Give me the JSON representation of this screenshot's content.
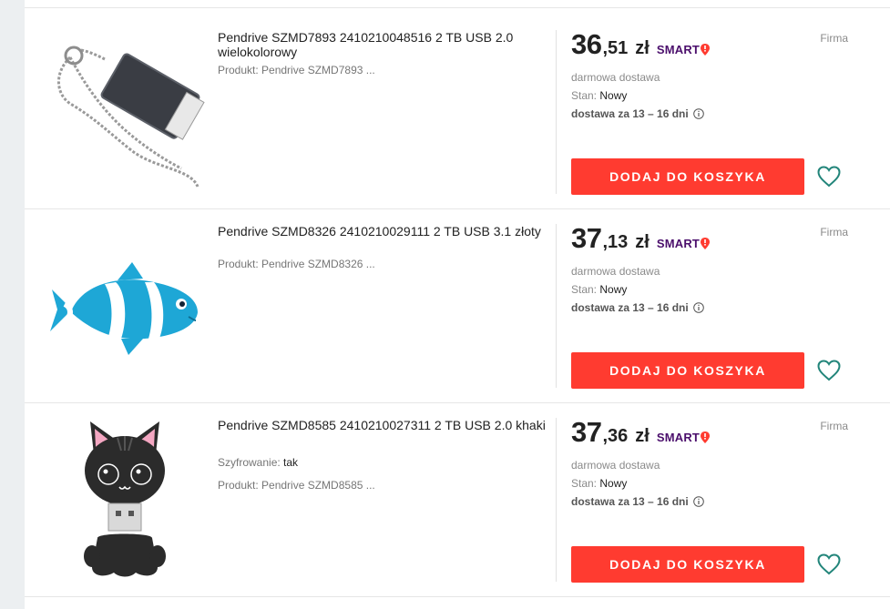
{
  "colors": {
    "button": "#ff3b30",
    "smart": "#4b0f6c",
    "heart": "#22857a"
  },
  "listings": [
    {
      "title": "Pendrive SZMD7893 2410210048516 2 TB USB 2.0 wielokolorowy",
      "attributes": [
        {
          "label": "Produkt: Pendrive SZMD7893 ..."
        }
      ],
      "price_int": "36",
      "price_dec": ",51",
      "currency": "zł",
      "smart": "SMART",
      "seller_type": "Firma",
      "shipping": "darmowa dostawa",
      "condition_label": "Stan: ",
      "condition_value": "Nowy",
      "delivery": "dostawa za 13 – 16 dni",
      "cart_button": "DODAJ DO KOSZYKA",
      "image": "usb-keychain-image"
    },
    {
      "title": "Pendrive SZMD8326 2410210029111 2 TB USB 3.1 złoty",
      "attributes": [
        {
          "label": "Produkt: Pendrive SZMD8326 ..."
        }
      ],
      "price_int": "37",
      "price_dec": ",13",
      "currency": "zł",
      "smart": "SMART",
      "seller_type": "Firma",
      "shipping": "darmowa dostawa",
      "condition_label": "Stan: ",
      "condition_value": "Nowy",
      "delivery": "dostawa za 13 – 16 dni",
      "cart_button": "DODAJ DO KOSZYKA",
      "image": "clownfish-usb-image"
    },
    {
      "title": "Pendrive SZMD8585 2410210027311 2 TB USB 2.0 khaki",
      "attributes": [
        {
          "label": "Szyfrowanie: ",
          "value": "tak"
        },
        {
          "label": "Produkt: Pendrive SZMD8585 ..."
        }
      ],
      "price_int": "37",
      "price_dec": ",36",
      "currency": "zł",
      "smart": "SMART",
      "seller_type": "Firma",
      "shipping": "darmowa dostawa",
      "condition_label": "Stan: ",
      "condition_value": "Nowy",
      "delivery": "dostawa za 13 – 16 dni",
      "cart_button": "DODAJ DO KOSZYKA",
      "image": "cat-usb-image"
    }
  ]
}
